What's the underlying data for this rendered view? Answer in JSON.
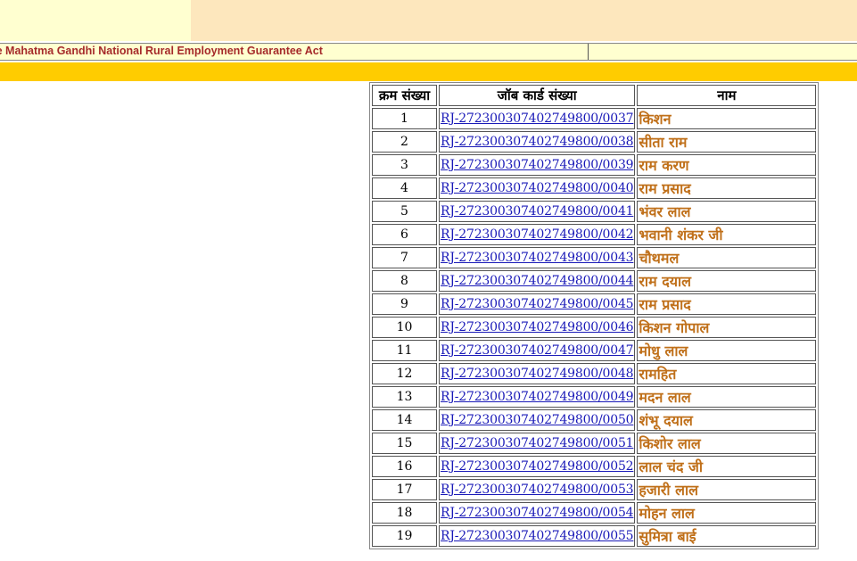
{
  "header": {
    "act_title": "he Mahatma Gandhi National Rural Employment Guarantee Act"
  },
  "table": {
    "columns": [
      "क्रम संख्या",
      "जॉब कार्ड संख्या",
      "नाम"
    ],
    "rows": [
      {
        "sr": "1",
        "job_card": "RJ-27230030740274980​0/0037",
        "name": "किशन"
      },
      {
        "sr": "2",
        "job_card": "RJ-272300307402749800/0038",
        "name": "सीता राम"
      },
      {
        "sr": "3",
        "job_card": "RJ-272300307402749800/0039",
        "name": "राम करण"
      },
      {
        "sr": "4",
        "job_card": "RJ-272300307402749800/0040",
        "name": "राम प्रसाद"
      },
      {
        "sr": "5",
        "job_card": "RJ-272300307402749800/0041",
        "name": "भंवर लाल"
      },
      {
        "sr": "6",
        "job_card": "RJ-272300307402749800/0042",
        "name": "भवानी शंकर जी"
      },
      {
        "sr": "7",
        "job_card": "RJ-272300307402749800/0043",
        "name": "चौथमल"
      },
      {
        "sr": "8",
        "job_card": "RJ-272300307402749800/0044",
        "name": "राम दयाल"
      },
      {
        "sr": "9",
        "job_card": "RJ-272300307402749800/0045",
        "name": "राम प्रसाद"
      },
      {
        "sr": "10",
        "job_card": "RJ-272300307402749800/0046",
        "name": "किशन गोपाल"
      },
      {
        "sr": "11",
        "job_card": "RJ-272300307402749800/0047",
        "name": "मोधु लाल"
      },
      {
        "sr": "12",
        "job_card": "RJ-272300307402749800/0048",
        "name": "रामहित"
      },
      {
        "sr": "13",
        "job_card": "RJ-272300307402749800/0049",
        "name": "मदन लाल"
      },
      {
        "sr": "14",
        "job_card": "RJ-272300307402749800/0050",
        "name": "शंभू दयाल"
      },
      {
        "sr": "15",
        "job_card": "RJ-272300307402749800/0051",
        "name": "किशोर लाल"
      },
      {
        "sr": "16",
        "job_card": "RJ-272300307402749800/0052",
        "name": "लाल चंद जी"
      },
      {
        "sr": "17",
        "job_card": "RJ-272300307402749800/0053",
        "name": "हजारी लाल"
      },
      {
        "sr": "18",
        "job_card": "RJ-272300307402749800/0054",
        "name": "मोहन लाल"
      },
      {
        "sr": "19",
        "job_card": "RJ-272300307402749800/0055",
        "name": "सुमित्रा बाई"
      }
    ]
  },
  "colors": {
    "link": "#1a1ab8",
    "name_text": "#c0701a",
    "gold_bar": "#ffcc00",
    "act_text": "#a52a2a"
  }
}
